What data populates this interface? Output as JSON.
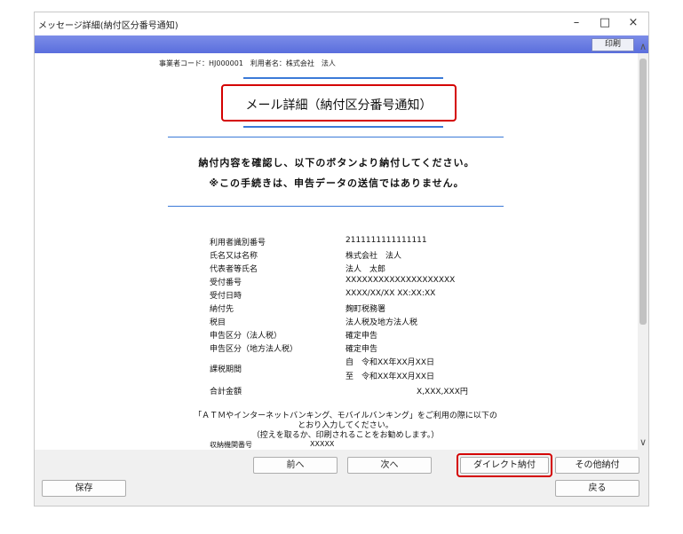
{
  "window": {
    "title": "メッセージ詳細(納付区分番号通知)",
    "minimize": "–",
    "maximize": "□",
    "close": "×"
  },
  "toolbar": {
    "print_label": "印刷"
  },
  "document": {
    "header": "事業者コード：HJ000001　利用者名：株式会社　法人",
    "title": "メール詳細（納付区分番号通知）",
    "message1": "納付内容を確認し、以下のボタンより納付してください。",
    "message2": "※この手続きは、申告データの送信ではありません。",
    "rows": [
      {
        "label": "利用者識別番号",
        "value": "2111111111111111"
      },
      {
        "label": "氏名又は名称",
        "value": "株式会社　法人"
      },
      {
        "label": "代表者等氏名",
        "value": "法人　太郎"
      },
      {
        "label": "受付番号",
        "value": "XXXXXXXXXXXXXXXXXXXX"
      },
      {
        "label": "受付日時",
        "value": "XXXX/XX/XX XX:XX:XX"
      },
      {
        "label": "納付先",
        "value": "麹町税務署"
      },
      {
        "label": "税目",
        "value": "法人税及地方法人税"
      },
      {
        "label": "申告区分（法人税）",
        "value": "確定申告"
      },
      {
        "label": "申告区分（地方法人税）",
        "value": "確定申告"
      }
    ],
    "period_label": "課税期間",
    "period_from": "自　令和XX年XX月XX日",
    "period_to": "至　令和XX年XX月XX日",
    "total_label": "合計金額",
    "total_value": "X,XXX,XXX円",
    "note1": "「ＡＴＭやインターネットバンキング、モバイルバンキング」をご利用の際に以下の",
    "note2": "とおり入力してください。",
    "note3": "（控えを取るか、印刷されることをお勧めします。）",
    "institution_label": "収納機関番号",
    "institution_value": "XXXXX"
  },
  "buttons": {
    "prev": "前へ",
    "next": "次へ",
    "direct_pay": "ダイレクト納付",
    "other_pay": "その他納付",
    "save": "保存",
    "back": "戻る"
  },
  "colors": {
    "accent": "#d40000",
    "menubar": "#5a6edd",
    "rule": "#3b7ad8"
  }
}
